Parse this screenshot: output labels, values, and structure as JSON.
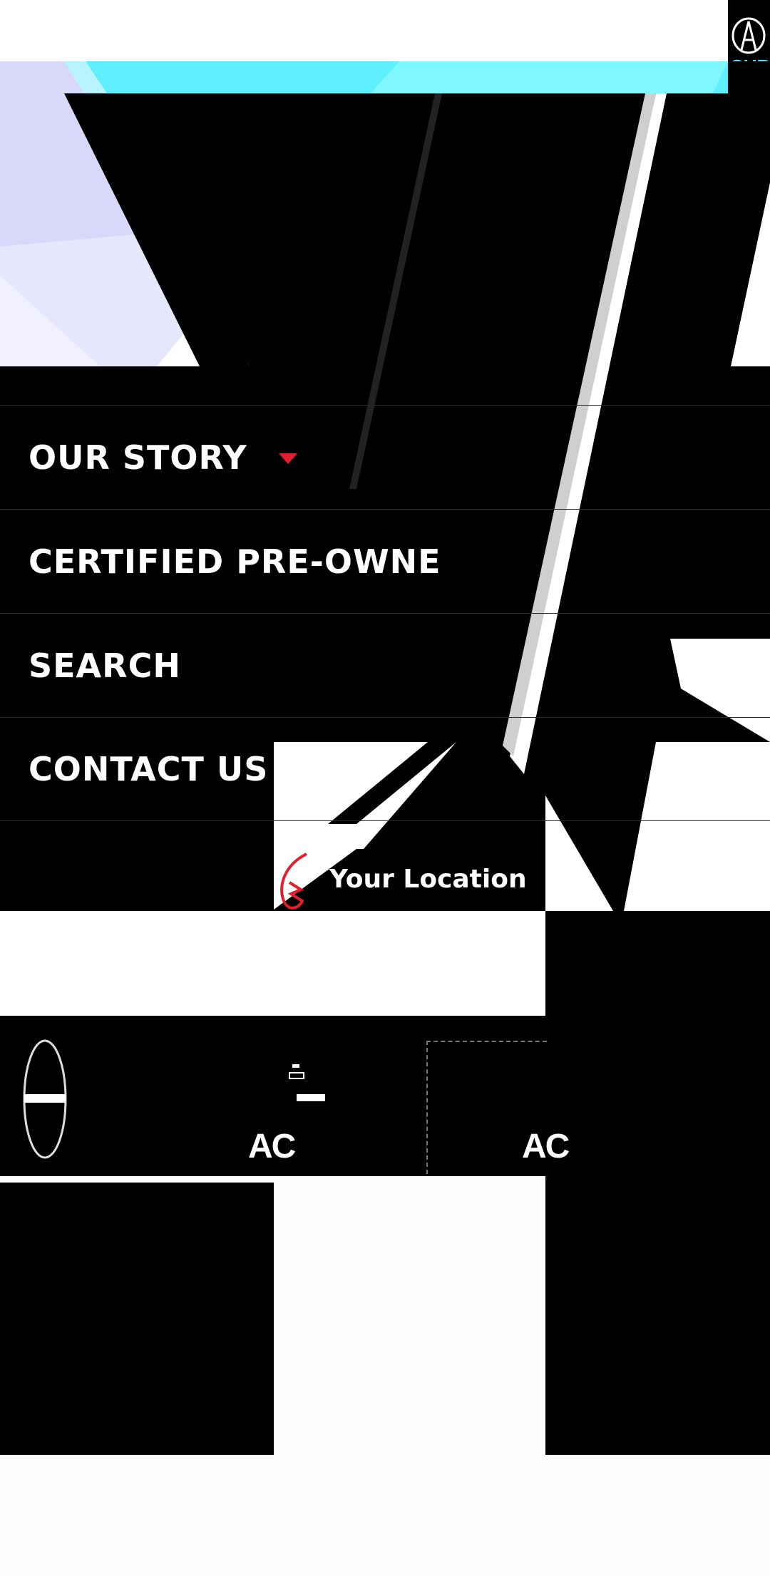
{
  "nav": {
    "items": [
      {
        "label": "OUR STORY",
        "has_dropdown": true
      },
      {
        "label": "CERTIFIED PRE-OWNE"
      },
      {
        "label": "SEARCH"
      },
      {
        "label": "CONTACT US"
      }
    ]
  },
  "location": {
    "label": "Your Location"
  },
  "footer": {
    "badge_left": "AC",
    "badge_right": "AC"
  },
  "colors": {
    "accent_red": "#e0202c",
    "cyan": "#49e8ff",
    "lavender": "#d6d6f8"
  },
  "icons": {
    "logo": "acura-logo-icon",
    "caret": "caret-down-icon",
    "pin": "location-pin-icon",
    "minus_circle": "minus-circle-icon"
  }
}
